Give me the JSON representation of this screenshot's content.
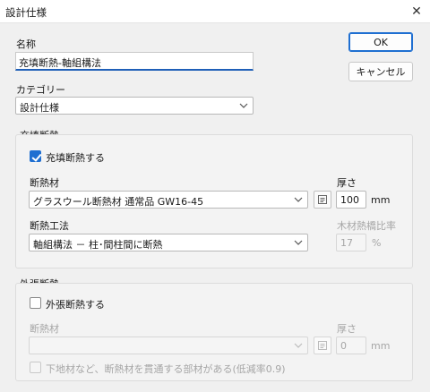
{
  "window": {
    "title": "設計仕様",
    "close_glyph": "✕"
  },
  "name": {
    "label": "名称",
    "value": "充填断熱-軸組構法"
  },
  "category": {
    "label": "カテゴリー",
    "value": "設計仕様"
  },
  "buttons": {
    "ok": "OK",
    "cancel": "キャンセル"
  },
  "fill_insulation": {
    "group_label": "充填断熱",
    "enable_label": "充填断熱する",
    "enabled": true,
    "material_label": "断熱材",
    "material_value": "グラスウール断熱材 通常品 GW16-45",
    "thickness_label": "厚さ",
    "thickness_value": "100",
    "thickness_unit": "mm",
    "method_label": "断熱工法",
    "method_value": "軸組構法 － 柱･間柱間に断熱",
    "wood_ratio_label": "木材熱橋比率",
    "wood_ratio_value": "17",
    "wood_ratio_unit": "%"
  },
  "exterior_insulation": {
    "group_label": "外張断熱",
    "enable_label": "外張断熱する",
    "enabled": false,
    "material_label": "断熱材",
    "material_value": "",
    "thickness_label": "厚さ",
    "thickness_value": "0",
    "thickness_unit": "mm",
    "penetration_label": "下地材など、断熱材を貫通する部材がある(低減率0.9)",
    "penetration_checked": false
  },
  "colors": {
    "accent": "#1f6fd1",
    "disabled_text": "#a6a6a6"
  },
  "icons": {
    "dropdown": "chevron-down-icon",
    "browse": "list-icon"
  }
}
